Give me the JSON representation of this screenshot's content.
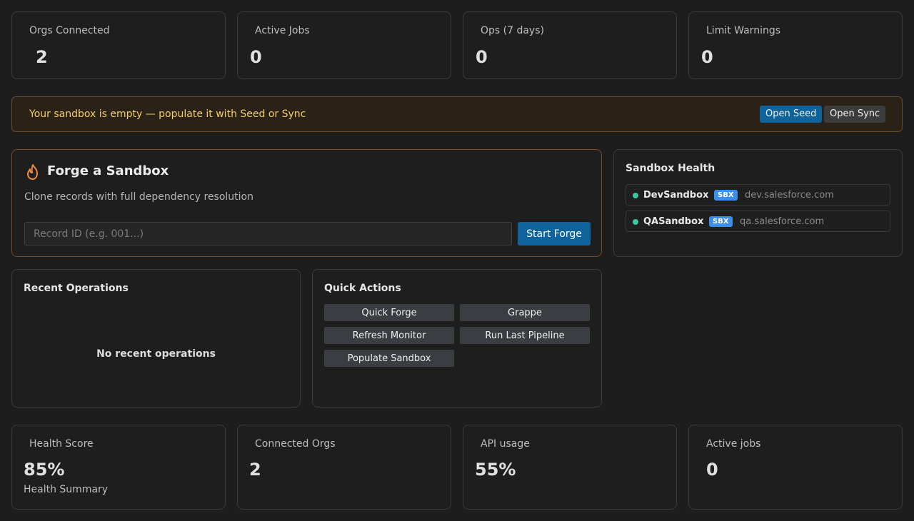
{
  "top_stats": [
    {
      "label": "Orgs Connected",
      "value": "2"
    },
    {
      "label": "Active Jobs",
      "value": "0"
    },
    {
      "label": "Ops (7 days)",
      "value": "0"
    },
    {
      "label": "Limit Warnings",
      "value": "0"
    }
  ],
  "banner": {
    "message": "Your sandbox is empty — populate it with Seed or Sync",
    "seed_button": "Open Seed",
    "sync_button": "Open Sync",
    "color": "#f4cf64"
  },
  "forge": {
    "icon": "flame-icon",
    "title": "Forge a Sandbox",
    "description": "Clone records with full dependency resolution",
    "input_placeholder": "Record ID (e.g. 001...)",
    "input_value": "",
    "start_button": "Start Forge"
  },
  "sandbox_health": {
    "title": "Sandbox Health",
    "orgs": [
      {
        "name": "DevSandbox",
        "badge": "SBX",
        "host": "dev.salesforce.com",
        "status_color": "#3ec5a1"
      },
      {
        "name": "QASandbox",
        "badge": "SBX",
        "host": "qa.salesforce.com",
        "status_color": "#3ec5a1"
      }
    ]
  },
  "recent_operations": {
    "title": "Recent Operations",
    "empty_text": "No recent operations"
  },
  "quick_actions": {
    "title": "Quick Actions",
    "items": [
      "Quick Forge",
      "Grappe",
      "Refresh Monitor",
      "Run Last Pipeline",
      "Populate Sandbox"
    ]
  },
  "bottom_stats": [
    {
      "label": "Health Score",
      "value": "85%",
      "sub": "Health Summary"
    },
    {
      "label": "Connected Orgs",
      "value": "2"
    },
    {
      "label": "API usage",
      "value": "55%"
    },
    {
      "label": "Active jobs",
      "value": "0"
    }
  ]
}
